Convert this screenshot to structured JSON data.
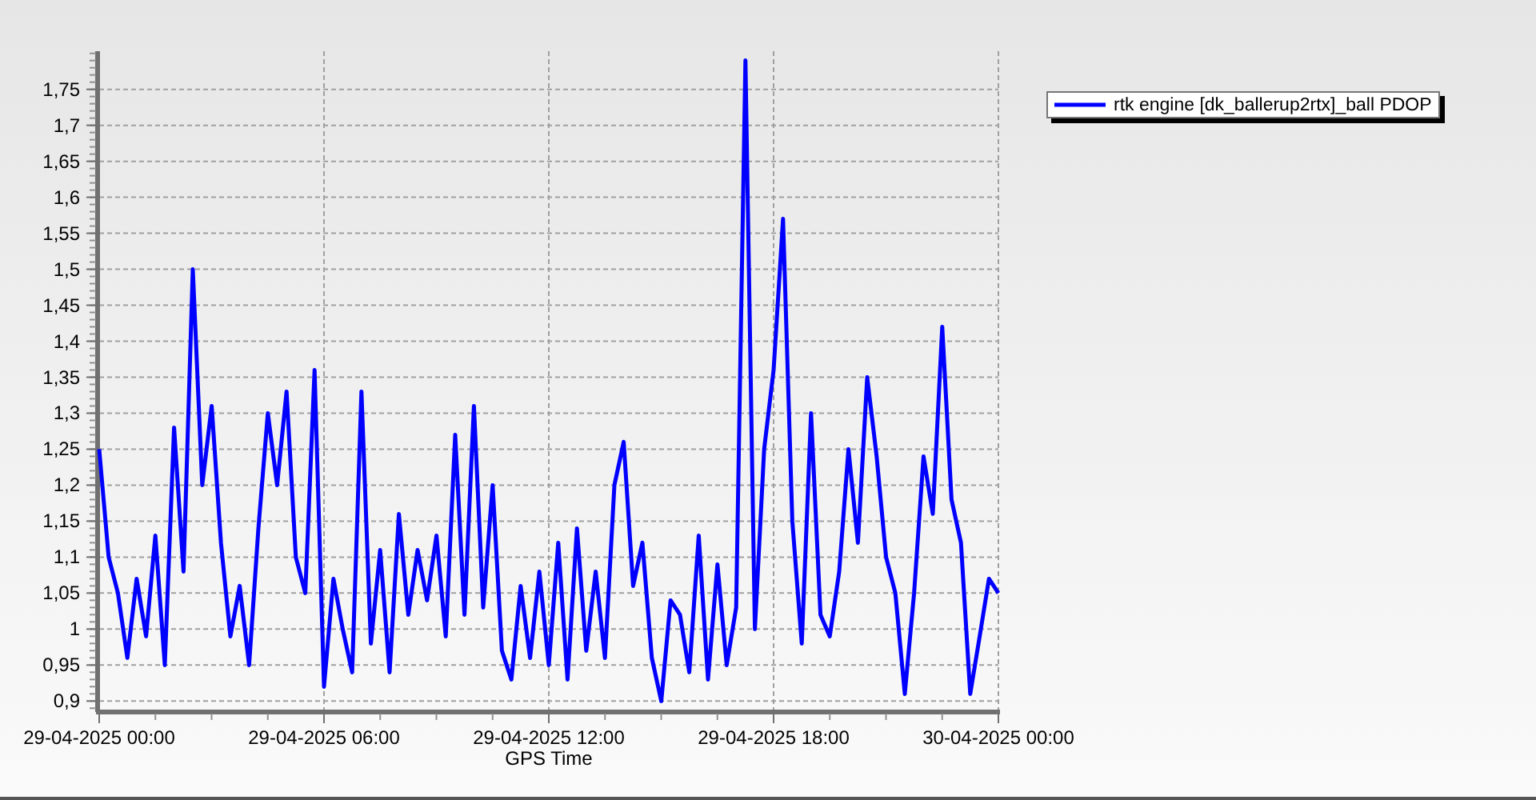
{
  "chart_data": {
    "type": "line",
    "grid": true,
    "xlabel": "GPS Time",
    "categories": [
      "29-04-2025 00:00",
      null,
      null,
      null,
      null,
      null,
      null,
      null,
      null,
      null,
      null,
      null,
      null,
      null,
      null,
      null,
      null,
      null,
      null,
      null,
      null,
      null,
      null,
      null,
      "29-04-2025 06:00",
      null,
      null,
      null,
      null,
      null,
      null,
      null,
      null,
      null,
      null,
      null,
      null,
      null,
      null,
      null,
      null,
      null,
      null,
      null,
      null,
      null,
      null,
      null,
      "29-04-2025 12:00",
      null,
      null,
      null,
      null,
      null,
      null,
      null,
      null,
      null,
      null,
      null,
      null,
      null,
      null,
      null,
      null,
      null,
      null,
      null,
      null,
      null,
      null,
      null,
      "29-04-2025 18:00",
      null,
      null,
      null,
      null,
      null,
      null,
      null,
      null,
      null,
      null,
      null,
      null,
      null,
      null,
      null,
      null,
      null,
      null,
      null,
      null,
      null,
      null,
      null,
      "30-04-2025 00:00"
    ],
    "series": [
      {
        "name": "rtk engine [dk_ballerup2rtx]_ball PDOP",
        "color": "#0000ff",
        "values": [
          1.25,
          1.1,
          1.05,
          0.96,
          1.07,
          0.99,
          1.13,
          0.95,
          1.28,
          1.08,
          1.5,
          1.2,
          1.31,
          1.12,
          0.99,
          1.06,
          0.95,
          1.14,
          1.3,
          1.2,
          1.33,
          1.1,
          1.05,
          1.36,
          0.92,
          1.07,
          1,
          0.94,
          1.33,
          0.98,
          1.11,
          0.94,
          1.16,
          1.02,
          1.11,
          1.04,
          1.13,
          0.99,
          1.27,
          1.02,
          1.31,
          1.03,
          1.2,
          0.97,
          0.93,
          1.06,
          0.96,
          1.08,
          0.95,
          1.12,
          0.93,
          1.14,
          0.97,
          1.08,
          0.96,
          1.2,
          1.26,
          1.06,
          1.12,
          0.96,
          0.9,
          1.04,
          1.02,
          0.94,
          1.13,
          0.93,
          1.09,
          0.95,
          1.03,
          1.79,
          1,
          1.25,
          1.36,
          1.57,
          1.15,
          0.98,
          1.3,
          1.02,
          0.99,
          1.08,
          1.25,
          1.12,
          1.35,
          1.24,
          1.1,
          1.05,
          0.91,
          1.05,
          1.24,
          1.16,
          1.42,
          1.18,
          1.12,
          0.91,
          0.99,
          1.07,
          1.05
        ]
      }
    ],
    "ylim": [
      0.887,
      1.803
    ],
    "yticks": [
      {
        "value": 0.9,
        "label": "0,9"
      },
      {
        "value": 0.95,
        "label": "0,95"
      },
      {
        "value": 1,
        "label": "1"
      },
      {
        "value": 1.05,
        "label": "1,05"
      },
      {
        "value": 1.1,
        "label": "1,1"
      },
      {
        "value": 1.15,
        "label": "1,15"
      },
      {
        "value": 1.2,
        "label": "1,2"
      },
      {
        "value": 1.25,
        "label": "1,25"
      },
      {
        "value": 1.3,
        "label": "1,3"
      },
      {
        "value": 1.35,
        "label": "1,35"
      },
      {
        "value": 1.4,
        "label": "1,4"
      },
      {
        "value": 1.45,
        "label": "1,45"
      },
      {
        "value": 1.5,
        "label": "1,5"
      },
      {
        "value": 1.55,
        "label": "1,55"
      },
      {
        "value": 1.6,
        "label": "1,6"
      },
      {
        "value": 1.65,
        "label": "1,65"
      },
      {
        "value": 1.7,
        "label": "1,7"
      },
      {
        "value": 1.75,
        "label": "1,75"
      }
    ]
  }
}
